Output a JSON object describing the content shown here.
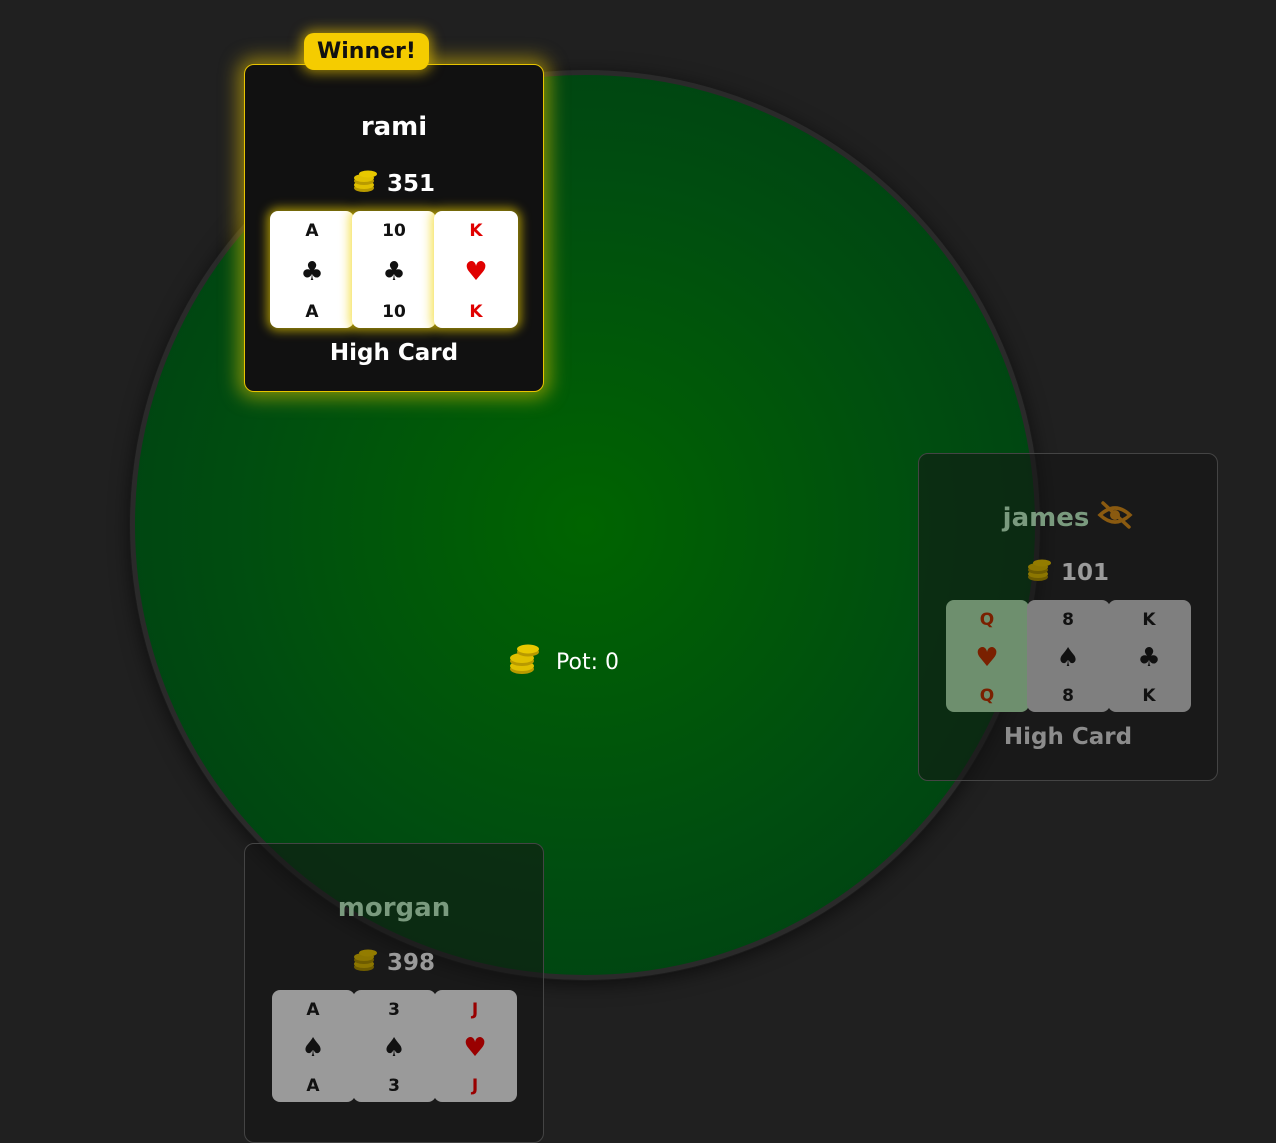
{
  "pot": {
    "label": "Pot: 0"
  },
  "players": {
    "rami": {
      "badge": "Winner!",
      "name": "rami",
      "chips": "351",
      "hand": "High Card",
      "cards": [
        {
          "rank": "A",
          "suit": "♣",
          "color": "black"
        },
        {
          "rank": "10",
          "suit": "♣",
          "color": "black"
        },
        {
          "rank": "K",
          "suit": "♥",
          "color": "red"
        }
      ]
    },
    "james": {
      "name": "james",
      "status_icon": "eye-slash-icon",
      "chips": "101",
      "hand": "High Card",
      "cards": [
        {
          "rank": "Q",
          "suit": "♥",
          "color": "red"
        },
        {
          "rank": "8",
          "suit": "♠",
          "color": "black"
        },
        {
          "rank": "K",
          "suit": "♣",
          "color": "black"
        }
      ]
    },
    "morgan": {
      "name": "morgan",
      "chips": "398",
      "cards": [
        {
          "rank": "A",
          "suit": "♠",
          "color": "black"
        },
        {
          "rank": "3",
          "suit": "♠",
          "color": "black"
        },
        {
          "rank": "J",
          "suit": "♥",
          "color": "red"
        }
      ]
    }
  },
  "colors": {
    "background": "#202020",
    "felt": "#006400",
    "winner_gold": "#f5cc00",
    "card_red": "#e00000"
  }
}
